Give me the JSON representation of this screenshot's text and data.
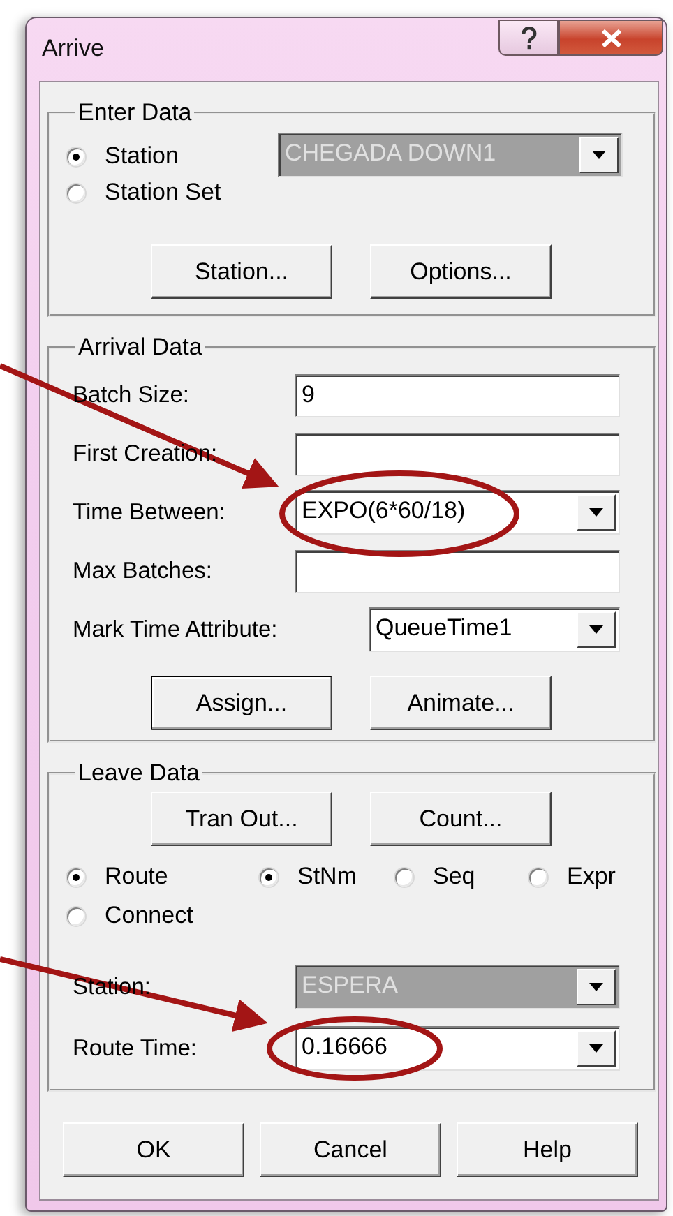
{
  "window": {
    "title": "Arrive"
  },
  "enter_data": {
    "legend": "Enter Data",
    "radios": [
      {
        "label": "Station",
        "selected": true
      },
      {
        "label": "Station Set",
        "selected": false
      }
    ],
    "station_combo": {
      "value": "CHEGADA DOWN1",
      "disabled": true
    },
    "buttons": [
      {
        "label": "Station...",
        "focused": false
      },
      {
        "label": "Options...",
        "focused": false
      }
    ]
  },
  "arrival_data": {
    "legend": "Arrival Data",
    "fields": [
      {
        "label": "Batch Size:",
        "kind": "text",
        "value": "9"
      },
      {
        "label": "First Creation:",
        "kind": "text"
      },
      {
        "label": "Time Between:",
        "kind": "combo",
        "value": "EXPO(6*60/18)"
      },
      {
        "label": "Max Batches:",
        "kind": "text"
      },
      {
        "label": "Mark Time Attribute:",
        "kind": "short-combo",
        "value": "QueueTime1"
      }
    ],
    "buttons": [
      {
        "label": "Assign...",
        "focused": true
      },
      {
        "label": "Animate...",
        "focused": false
      }
    ]
  },
  "leave_data": {
    "legend": "Leave Data",
    "buttons": [
      {
        "label": "Tran Out...",
        "focused": false
      },
      {
        "label": "Count...",
        "focused": false
      }
    ],
    "route_modes": [
      {
        "label": "Route",
        "selected": true
      },
      {
        "label": "Connect",
        "selected": false
      }
    ],
    "destinations": [
      {
        "label": "StNm",
        "selected": true
      },
      {
        "label": "Seq",
        "selected": false
      },
      {
        "label": "Expr",
        "selected": false
      }
    ],
    "fields": [
      {
        "label": "Station:",
        "kind": "combo",
        "value": "ESPERA",
        "disabled": true
      },
      {
        "label": "Route Time:",
        "kind": "combo",
        "value": "0.16666"
      }
    ]
  },
  "buttons": [
    {
      "label": "OK"
    },
    {
      "label": "Cancel"
    },
    {
      "label": "Help"
    }
  ]
}
